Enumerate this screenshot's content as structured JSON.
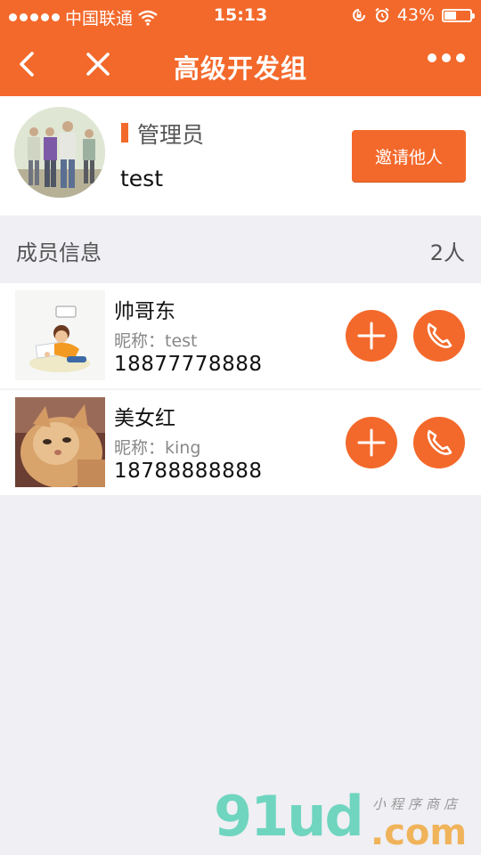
{
  "status_bar": {
    "carrier": "中国联通",
    "time": "15:13",
    "battery_percent": "43%",
    "battery_level": 0.43,
    "icons": [
      "signal-dots-icon",
      "wifi-icon",
      "orientation-lock-icon",
      "alarm-icon",
      "battery-icon"
    ]
  },
  "nav": {
    "title": "高级开发组",
    "icons": [
      "back-icon",
      "close-icon",
      "more-icon"
    ]
  },
  "profile": {
    "role": "管理员",
    "name": "test",
    "invite_label": "邀请他人"
  },
  "members_section": {
    "label": "成员信息",
    "count": "2人"
  },
  "members": [
    {
      "name": "帅哥东",
      "nickname": "昵称：test",
      "phone": "18877778888"
    },
    {
      "name": "美女红",
      "nickname": "昵称：king",
      "phone": "18788888888"
    }
  ],
  "watermark": {
    "logo": "91ud",
    "domain": ".com",
    "tagline": "小程序商店"
  },
  "colors": {
    "accent": "#f3692b",
    "background": "#efeff4",
    "watermark_green": "#6fd5bf",
    "watermark_orange": "#f0b35a"
  }
}
